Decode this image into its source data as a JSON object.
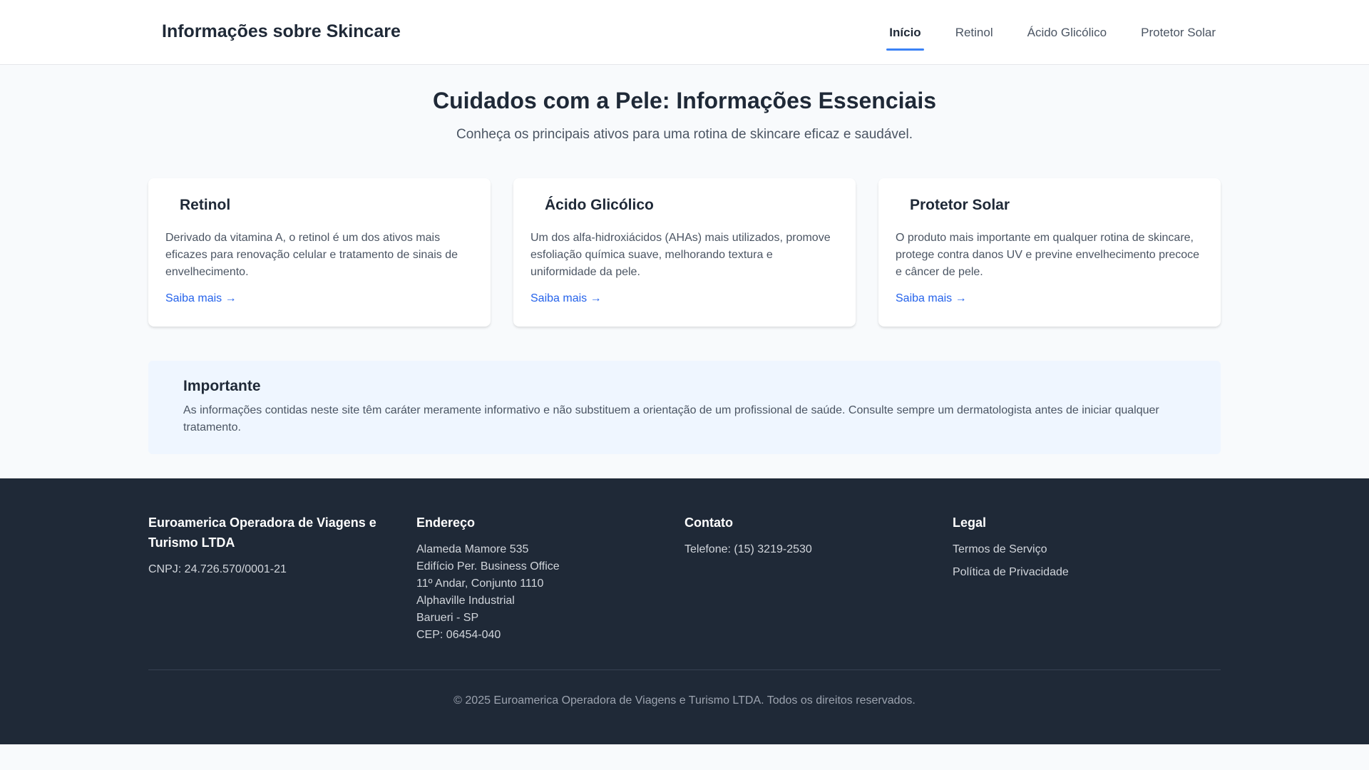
{
  "header": {
    "brand": "Informações sobre Skincare",
    "nav": [
      {
        "label": "Início",
        "active": true
      },
      {
        "label": "Retinol"
      },
      {
        "label": "Ácido Glicólico"
      },
      {
        "label": "Protetor Solar"
      }
    ]
  },
  "hero": {
    "title": "Cuidados com a Pele: Informações Essenciais",
    "subtitle": "Conheça os principais ativos para uma rotina de skincare eficaz e saudável."
  },
  "cards": [
    {
      "title": "Retinol",
      "text": "Derivado da vitamina A, o retinol é um dos ativos mais eficazes para renovação celular e tratamento de sinais de envelhecimento.",
      "link": "Saiba mais →"
    },
    {
      "title": "Ácido Glicólico",
      "text": "Um dos alfa-hidroxiácidos (AHAs) mais utilizados, promove esfoliação química suave, melhorando textura e uniformidade da pele.",
      "link": "Saiba mais →"
    },
    {
      "title": "Protetor Solar",
      "text": "O produto mais importante em qualquer rotina de skincare, protege contra danos UV e previne envelhecimento precoce e câncer de pele.",
      "link": "Saiba mais →"
    }
  ],
  "notice": {
    "title": "Importante",
    "text": "As informações contidas neste site têm caráter meramente informativo e não substituem a orientação de um profissional de saúde. Consulte sempre um dermatologista antes de iniciar qualquer tratamento."
  },
  "footer": {
    "company": {
      "title": "Euroamerica Operadora de Viagens e Turismo LTDA",
      "cnpj": "CNPJ: 24.726.570/0001-21"
    },
    "address": {
      "title": "Endereço",
      "lines": [
        "Alameda Mamore 535",
        "Edifício Per. Business Office",
        "11º Andar, Conjunto 1110",
        "Alphaville Industrial",
        "Barueri - SP",
        "CEP: 06454-040"
      ]
    },
    "contact": {
      "title": "Contato",
      "phone": "Telefone: (15) 3219-2530"
    },
    "legal": {
      "title": "Legal",
      "links": [
        "Termos de Serviço",
        "Política de Privacidade"
      ]
    },
    "copyright": "© 2025 Euroamerica Operadora de Viagens e Turismo LTDA. Todos os direitos reservados."
  }
}
